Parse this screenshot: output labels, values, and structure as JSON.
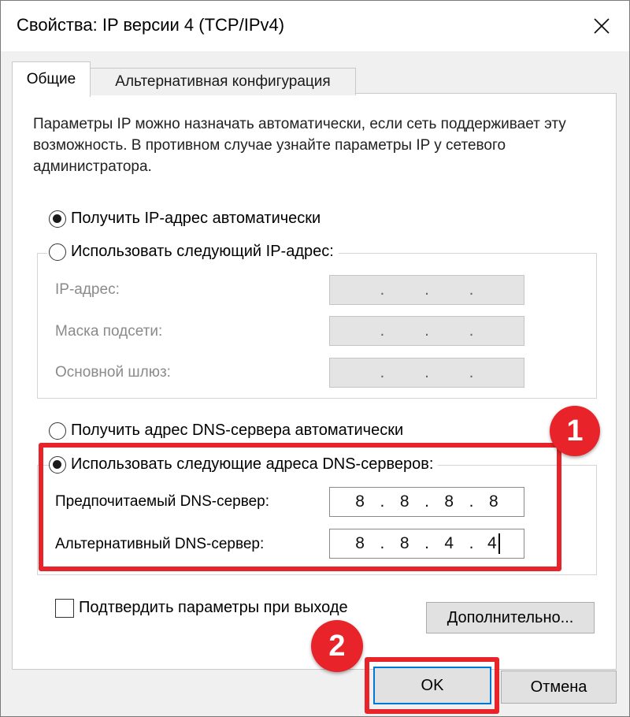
{
  "window": {
    "title": "Свойства: IP версии 4 (TCP/IPv4)",
    "close_icon": "close-icon"
  },
  "tabs": [
    {
      "label": "Общие",
      "active": true
    },
    {
      "label": "Альтернативная конфигурация",
      "active": false
    }
  ],
  "description": "Параметры IP можно назначать автоматически, если сеть поддерживает эту возможность. В противном случае узнайте параметры IP у сетевого администратора.",
  "ip_section": {
    "auto_label": "Получить IP-адрес автоматически",
    "auto_checked": true,
    "manual_label": "Использовать следующий IP-адрес:",
    "manual_checked": false,
    "fields": [
      {
        "label": "IP-адрес:",
        "value": [
          "",
          "",
          "",
          ""
        ]
      },
      {
        "label": "Маска подсети:",
        "value": [
          "",
          "",
          "",
          ""
        ]
      },
      {
        "label": "Основной шлюз:",
        "value": [
          "",
          "",
          "",
          ""
        ]
      }
    ]
  },
  "dns_section": {
    "auto_label": "Получить адрес DNS-сервера автоматически",
    "auto_checked": false,
    "manual_label": "Использовать следующие адреса DNS-серверов:",
    "manual_checked": true,
    "preferred": {
      "label": "Предпочитаемый DNS-сервер:",
      "octets": [
        "8",
        "8",
        "8",
        "8"
      ]
    },
    "alternate": {
      "label": "Альтернативный DNS-сервер:",
      "octets": [
        "8",
        "8",
        "4",
        "4"
      ]
    }
  },
  "confirm": {
    "label": "Подтвердить параметры при выходе",
    "checked": false
  },
  "buttons": {
    "advanced": "Дополнительно...",
    "ok": "OK",
    "cancel": "Отмена"
  },
  "annotations": {
    "badge1": "1",
    "badge2": "2",
    "color": "#e8242a"
  },
  "ip_separator": "."
}
